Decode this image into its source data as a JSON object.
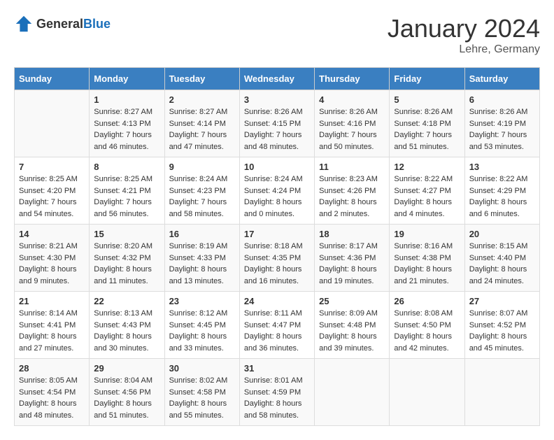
{
  "header": {
    "logo_general": "General",
    "logo_blue": "Blue",
    "title": "January 2024",
    "location": "Lehre, Germany"
  },
  "days_of_week": [
    "Sunday",
    "Monday",
    "Tuesday",
    "Wednesday",
    "Thursday",
    "Friday",
    "Saturday"
  ],
  "weeks": [
    [
      {
        "day": "",
        "sunrise": "",
        "sunset": "",
        "daylight": ""
      },
      {
        "day": "1",
        "sunrise": "Sunrise: 8:27 AM",
        "sunset": "Sunset: 4:13 PM",
        "daylight": "Daylight: 7 hours and 46 minutes."
      },
      {
        "day": "2",
        "sunrise": "Sunrise: 8:27 AM",
        "sunset": "Sunset: 4:14 PM",
        "daylight": "Daylight: 7 hours and 47 minutes."
      },
      {
        "day": "3",
        "sunrise": "Sunrise: 8:26 AM",
        "sunset": "Sunset: 4:15 PM",
        "daylight": "Daylight: 7 hours and 48 minutes."
      },
      {
        "day": "4",
        "sunrise": "Sunrise: 8:26 AM",
        "sunset": "Sunset: 4:16 PM",
        "daylight": "Daylight: 7 hours and 50 minutes."
      },
      {
        "day": "5",
        "sunrise": "Sunrise: 8:26 AM",
        "sunset": "Sunset: 4:18 PM",
        "daylight": "Daylight: 7 hours and 51 minutes."
      },
      {
        "day": "6",
        "sunrise": "Sunrise: 8:26 AM",
        "sunset": "Sunset: 4:19 PM",
        "daylight": "Daylight: 7 hours and 53 minutes."
      }
    ],
    [
      {
        "day": "7",
        "sunrise": "Sunrise: 8:25 AM",
        "sunset": "Sunset: 4:20 PM",
        "daylight": "Daylight: 7 hours and 54 minutes."
      },
      {
        "day": "8",
        "sunrise": "Sunrise: 8:25 AM",
        "sunset": "Sunset: 4:21 PM",
        "daylight": "Daylight: 7 hours and 56 minutes."
      },
      {
        "day": "9",
        "sunrise": "Sunrise: 8:24 AM",
        "sunset": "Sunset: 4:23 PM",
        "daylight": "Daylight: 7 hours and 58 minutes."
      },
      {
        "day": "10",
        "sunrise": "Sunrise: 8:24 AM",
        "sunset": "Sunset: 4:24 PM",
        "daylight": "Daylight: 8 hours and 0 minutes."
      },
      {
        "day": "11",
        "sunrise": "Sunrise: 8:23 AM",
        "sunset": "Sunset: 4:26 PM",
        "daylight": "Daylight: 8 hours and 2 minutes."
      },
      {
        "day": "12",
        "sunrise": "Sunrise: 8:22 AM",
        "sunset": "Sunset: 4:27 PM",
        "daylight": "Daylight: 8 hours and 4 minutes."
      },
      {
        "day": "13",
        "sunrise": "Sunrise: 8:22 AM",
        "sunset": "Sunset: 4:29 PM",
        "daylight": "Daylight: 8 hours and 6 minutes."
      }
    ],
    [
      {
        "day": "14",
        "sunrise": "Sunrise: 8:21 AM",
        "sunset": "Sunset: 4:30 PM",
        "daylight": "Daylight: 8 hours and 9 minutes."
      },
      {
        "day": "15",
        "sunrise": "Sunrise: 8:20 AM",
        "sunset": "Sunset: 4:32 PM",
        "daylight": "Daylight: 8 hours and 11 minutes."
      },
      {
        "day": "16",
        "sunrise": "Sunrise: 8:19 AM",
        "sunset": "Sunset: 4:33 PM",
        "daylight": "Daylight: 8 hours and 13 minutes."
      },
      {
        "day": "17",
        "sunrise": "Sunrise: 8:18 AM",
        "sunset": "Sunset: 4:35 PM",
        "daylight": "Daylight: 8 hours and 16 minutes."
      },
      {
        "day": "18",
        "sunrise": "Sunrise: 8:17 AM",
        "sunset": "Sunset: 4:36 PM",
        "daylight": "Daylight: 8 hours and 19 minutes."
      },
      {
        "day": "19",
        "sunrise": "Sunrise: 8:16 AM",
        "sunset": "Sunset: 4:38 PM",
        "daylight": "Daylight: 8 hours and 21 minutes."
      },
      {
        "day": "20",
        "sunrise": "Sunrise: 8:15 AM",
        "sunset": "Sunset: 4:40 PM",
        "daylight": "Daylight: 8 hours and 24 minutes."
      }
    ],
    [
      {
        "day": "21",
        "sunrise": "Sunrise: 8:14 AM",
        "sunset": "Sunset: 4:41 PM",
        "daylight": "Daylight: 8 hours and 27 minutes."
      },
      {
        "day": "22",
        "sunrise": "Sunrise: 8:13 AM",
        "sunset": "Sunset: 4:43 PM",
        "daylight": "Daylight: 8 hours and 30 minutes."
      },
      {
        "day": "23",
        "sunrise": "Sunrise: 8:12 AM",
        "sunset": "Sunset: 4:45 PM",
        "daylight": "Daylight: 8 hours and 33 minutes."
      },
      {
        "day": "24",
        "sunrise": "Sunrise: 8:11 AM",
        "sunset": "Sunset: 4:47 PM",
        "daylight": "Daylight: 8 hours and 36 minutes."
      },
      {
        "day": "25",
        "sunrise": "Sunrise: 8:09 AM",
        "sunset": "Sunset: 4:48 PM",
        "daylight": "Daylight: 8 hours and 39 minutes."
      },
      {
        "day": "26",
        "sunrise": "Sunrise: 8:08 AM",
        "sunset": "Sunset: 4:50 PM",
        "daylight": "Daylight: 8 hours and 42 minutes."
      },
      {
        "day": "27",
        "sunrise": "Sunrise: 8:07 AM",
        "sunset": "Sunset: 4:52 PM",
        "daylight": "Daylight: 8 hours and 45 minutes."
      }
    ],
    [
      {
        "day": "28",
        "sunrise": "Sunrise: 8:05 AM",
        "sunset": "Sunset: 4:54 PM",
        "daylight": "Daylight: 8 hours and 48 minutes."
      },
      {
        "day": "29",
        "sunrise": "Sunrise: 8:04 AM",
        "sunset": "Sunset: 4:56 PM",
        "daylight": "Daylight: 8 hours and 51 minutes."
      },
      {
        "day": "30",
        "sunrise": "Sunrise: 8:02 AM",
        "sunset": "Sunset: 4:58 PM",
        "daylight": "Daylight: 8 hours and 55 minutes."
      },
      {
        "day": "31",
        "sunrise": "Sunrise: 8:01 AM",
        "sunset": "Sunset: 4:59 PM",
        "daylight": "Daylight: 8 hours and 58 minutes."
      },
      {
        "day": "",
        "sunrise": "",
        "sunset": "",
        "daylight": ""
      },
      {
        "day": "",
        "sunrise": "",
        "sunset": "",
        "daylight": ""
      },
      {
        "day": "",
        "sunrise": "",
        "sunset": "",
        "daylight": ""
      }
    ]
  ]
}
